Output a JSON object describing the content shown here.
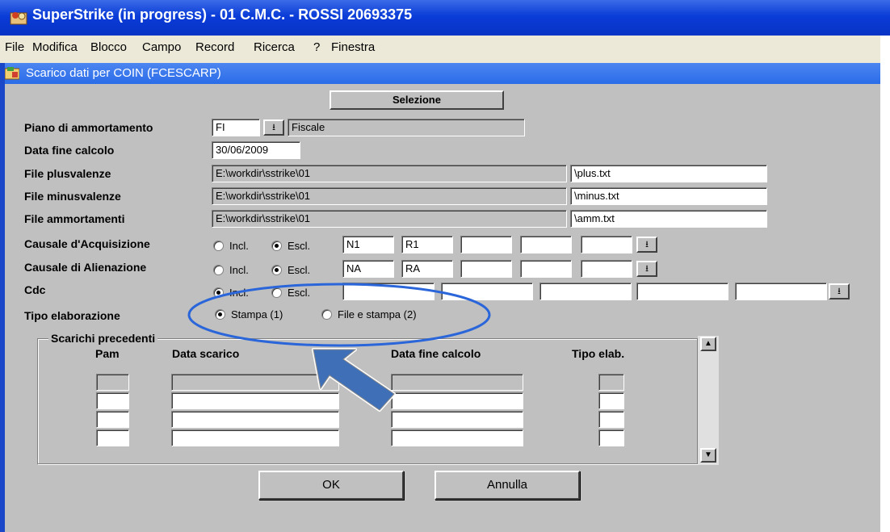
{
  "window": {
    "title": "SuperStrike (in progress) - 01 C.M.C. - ROSSI 20693375"
  },
  "menu": [
    "File",
    "Modifica",
    "Blocco",
    "Campo",
    "Record",
    "Ricerca",
    "?",
    "Finestra"
  ],
  "form": {
    "title": "Scarico dati per COIN (FCESCARP)",
    "selection_label": "Selezione",
    "piano": {
      "label": "Piano di ammortamento",
      "code": "FI",
      "description": "Fiscale"
    },
    "data_fine": {
      "label": "Data fine calcolo",
      "value": "30/06/2009"
    },
    "files": [
      {
        "label": "File plusvalenze",
        "path": "E:\\workdir\\sstrike\\01",
        "name": "\\plus.txt"
      },
      {
        "label": "File minusvalenze",
        "path": "E:\\workdir\\sstrike\\01",
        "name": "\\minus.txt"
      },
      {
        "label": "File ammortamenti",
        "path": "E:\\workdir\\sstrike\\01",
        "name": "\\amm.txt"
      }
    ],
    "causali": [
      {
        "label": "Causale d'Acquisizione",
        "incl": "Incl.",
        "escl": "Escl.",
        "selected": "escl",
        "values": [
          "N1",
          "R1",
          "",
          "",
          ""
        ]
      },
      {
        "label": "Causale di Alienazione",
        "incl": "Incl.",
        "escl": "Escl.",
        "selected": "escl",
        "values": [
          "NA",
          "RA",
          "",
          "",
          ""
        ]
      },
      {
        "label": "Cdc",
        "incl": "Incl.",
        "escl": "Escl.",
        "selected": "incl",
        "values": [
          "",
          "",
          "",
          "",
          ""
        ]
      }
    ],
    "tipo": {
      "label": "Tipo elaborazione",
      "option1": "Stampa (1)",
      "option2": "File e stampa (2)",
      "selected": 1
    },
    "scarichi": {
      "title": "Scarichi precedenti",
      "columns": [
        "Pam",
        "Data scarico",
        "Data fine calcolo",
        "Tipo elab."
      ],
      "row_count": 4
    },
    "buttons": {
      "ok": "OK",
      "cancel": "Annulla"
    }
  },
  "icons": {
    "dropdown": "dropdown-arrow-icon",
    "scroll_up": "scroll-up-icon",
    "scroll_down": "scroll-down-icon"
  },
  "colors": {
    "titlebar": "#0a3cd8",
    "form_bg": "#c0c0c0",
    "callout": "#2a66d9",
    "arrow": "#3e6fb7"
  }
}
